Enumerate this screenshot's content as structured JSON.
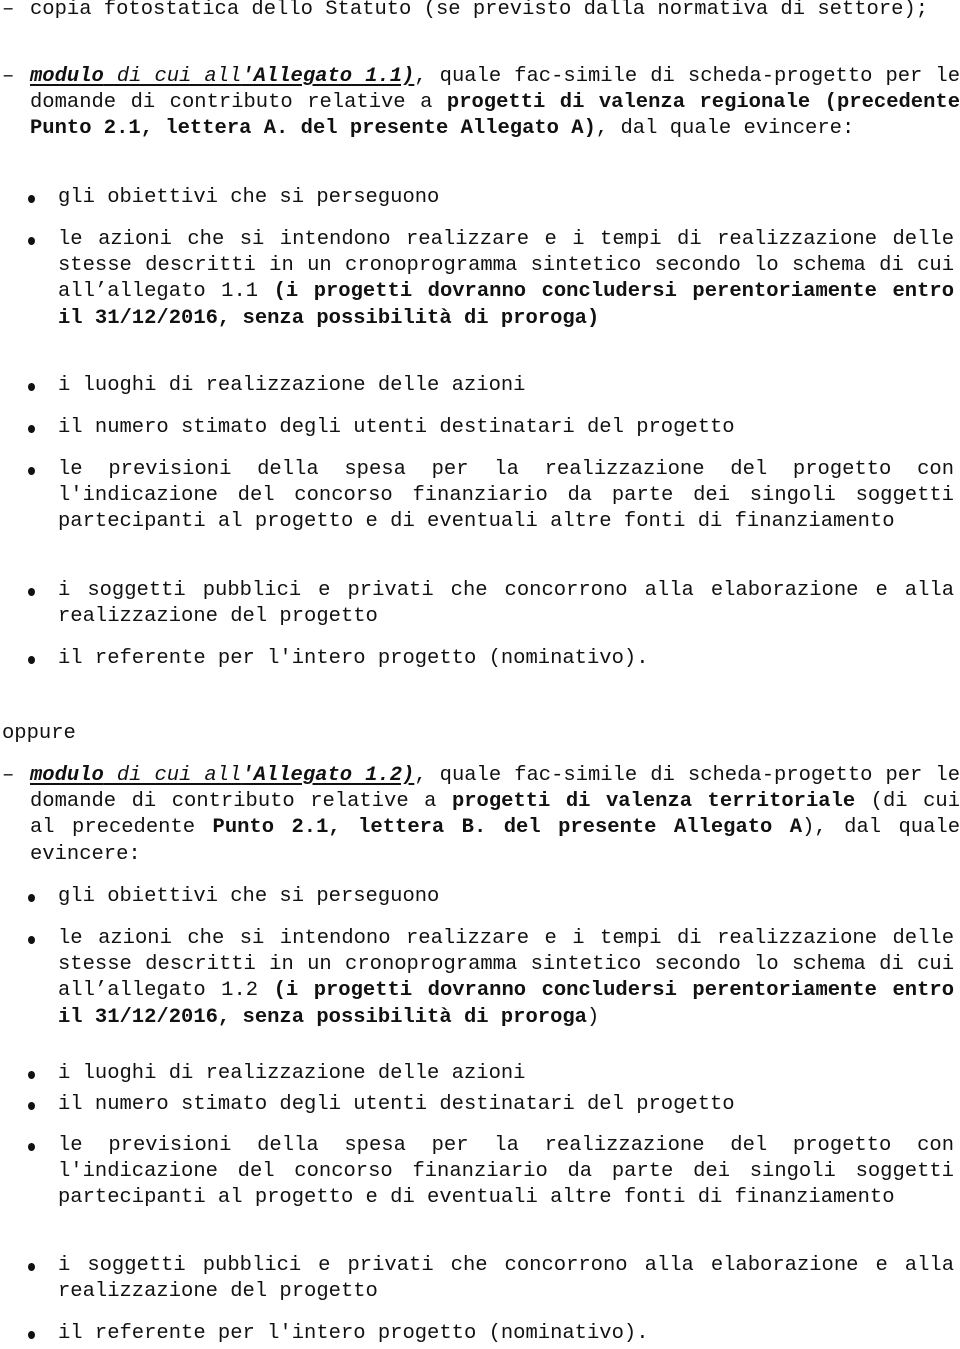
{
  "document": {
    "intro_item": {
      "marker": "–",
      "text": "copia fotostatica dello Statuto (se previsto dalla normativa di settore);"
    },
    "module_1": {
      "marker": "–",
      "link_bold_1": "modulo",
      "link_italic": " di cui all",
      "link_bold_2": "'Allegato 1.1)",
      "text_1": ", quale fac-simile di scheda-progetto per le domande di contributo relative a ",
      "bold_1": "progetti di valenza regionale (precedente Punto 2.1, lettera A. del presente Allegato A)",
      "text_2": ", dal quale evincere:",
      "items": [
        {
          "text": "gli obiettivi che si perseguono"
        },
        {
          "text": "le azioni che si intendono realizzare e i tempi di realizzazione delle stesse descritti in un cronoprogramma sintetico secondo lo schema di cui all’allegato 1.1 ",
          "bold": "(i progetti dovranno concludersi perentoriamente entro il 31/12/2016, senza possibilità di proroga)",
          "tail": ""
        },
        {
          "text": "i luoghi di realizzazione delle azioni"
        },
        {
          "text": "il numero stimato degli utenti destinatari del progetto"
        },
        {
          "text": "le previsioni della spesa per la realizzazione del progetto con l'indicazione del concorso finanziario da parte dei singoli soggetti partecipanti al progetto e di eventuali altre fonti di finanziamento"
        },
        {
          "text": "i soggetti pubblici e privati che concorrono alla elaborazione e alla realizzazione del progetto"
        },
        {
          "text": "il referente per l'intero progetto (nominativo)."
        }
      ]
    },
    "separator": "oppure",
    "module_2": {
      "marker": "–",
      "link_bold_1": "modulo",
      "link_italic": " di cui all",
      "link_bold_2": "'Allegato 1.2)",
      "text_1": ", quale fac-simile di scheda-progetto per le domande di contributo relative a ",
      "bold_1": "progetti di valenza territoriale",
      "text_2": " (di cui al precedente ",
      "bold_2": "Punto 2.1, lettera B. del presente Allegato A",
      "text_3": "), dal quale evincere:",
      "items": [
        {
          "text": "gli obiettivi che si perseguono"
        },
        {
          "text": "le azioni che si intendono realizzare e i tempi di realizzazione delle stesse descritti in un cronoprogramma sintetico secondo lo schema di cui all’allegato 1.2 ",
          "bold": "(i progetti dovranno concludersi perentoriamente entro il 31/12/2016, senza possibilità di proroga",
          "tail": ")"
        },
        {
          "text": "i luoghi di realizzazione delle azioni"
        },
        {
          "text": "il numero stimato degli utenti destinatari del progetto"
        },
        {
          "text": "le previsioni della spesa per la realizzazione del progetto con l'indicazione del concorso finanziario da parte dei singoli soggetti partecipanti al progetto e di eventuali altre fonti di finanziamento"
        },
        {
          "text": "i soggetti pubblici e privati che concorrono alla elaborazione e alla realizzazione del progetto"
        },
        {
          "text": "il referente per l'intero progetto (nominativo)."
        }
      ]
    }
  }
}
